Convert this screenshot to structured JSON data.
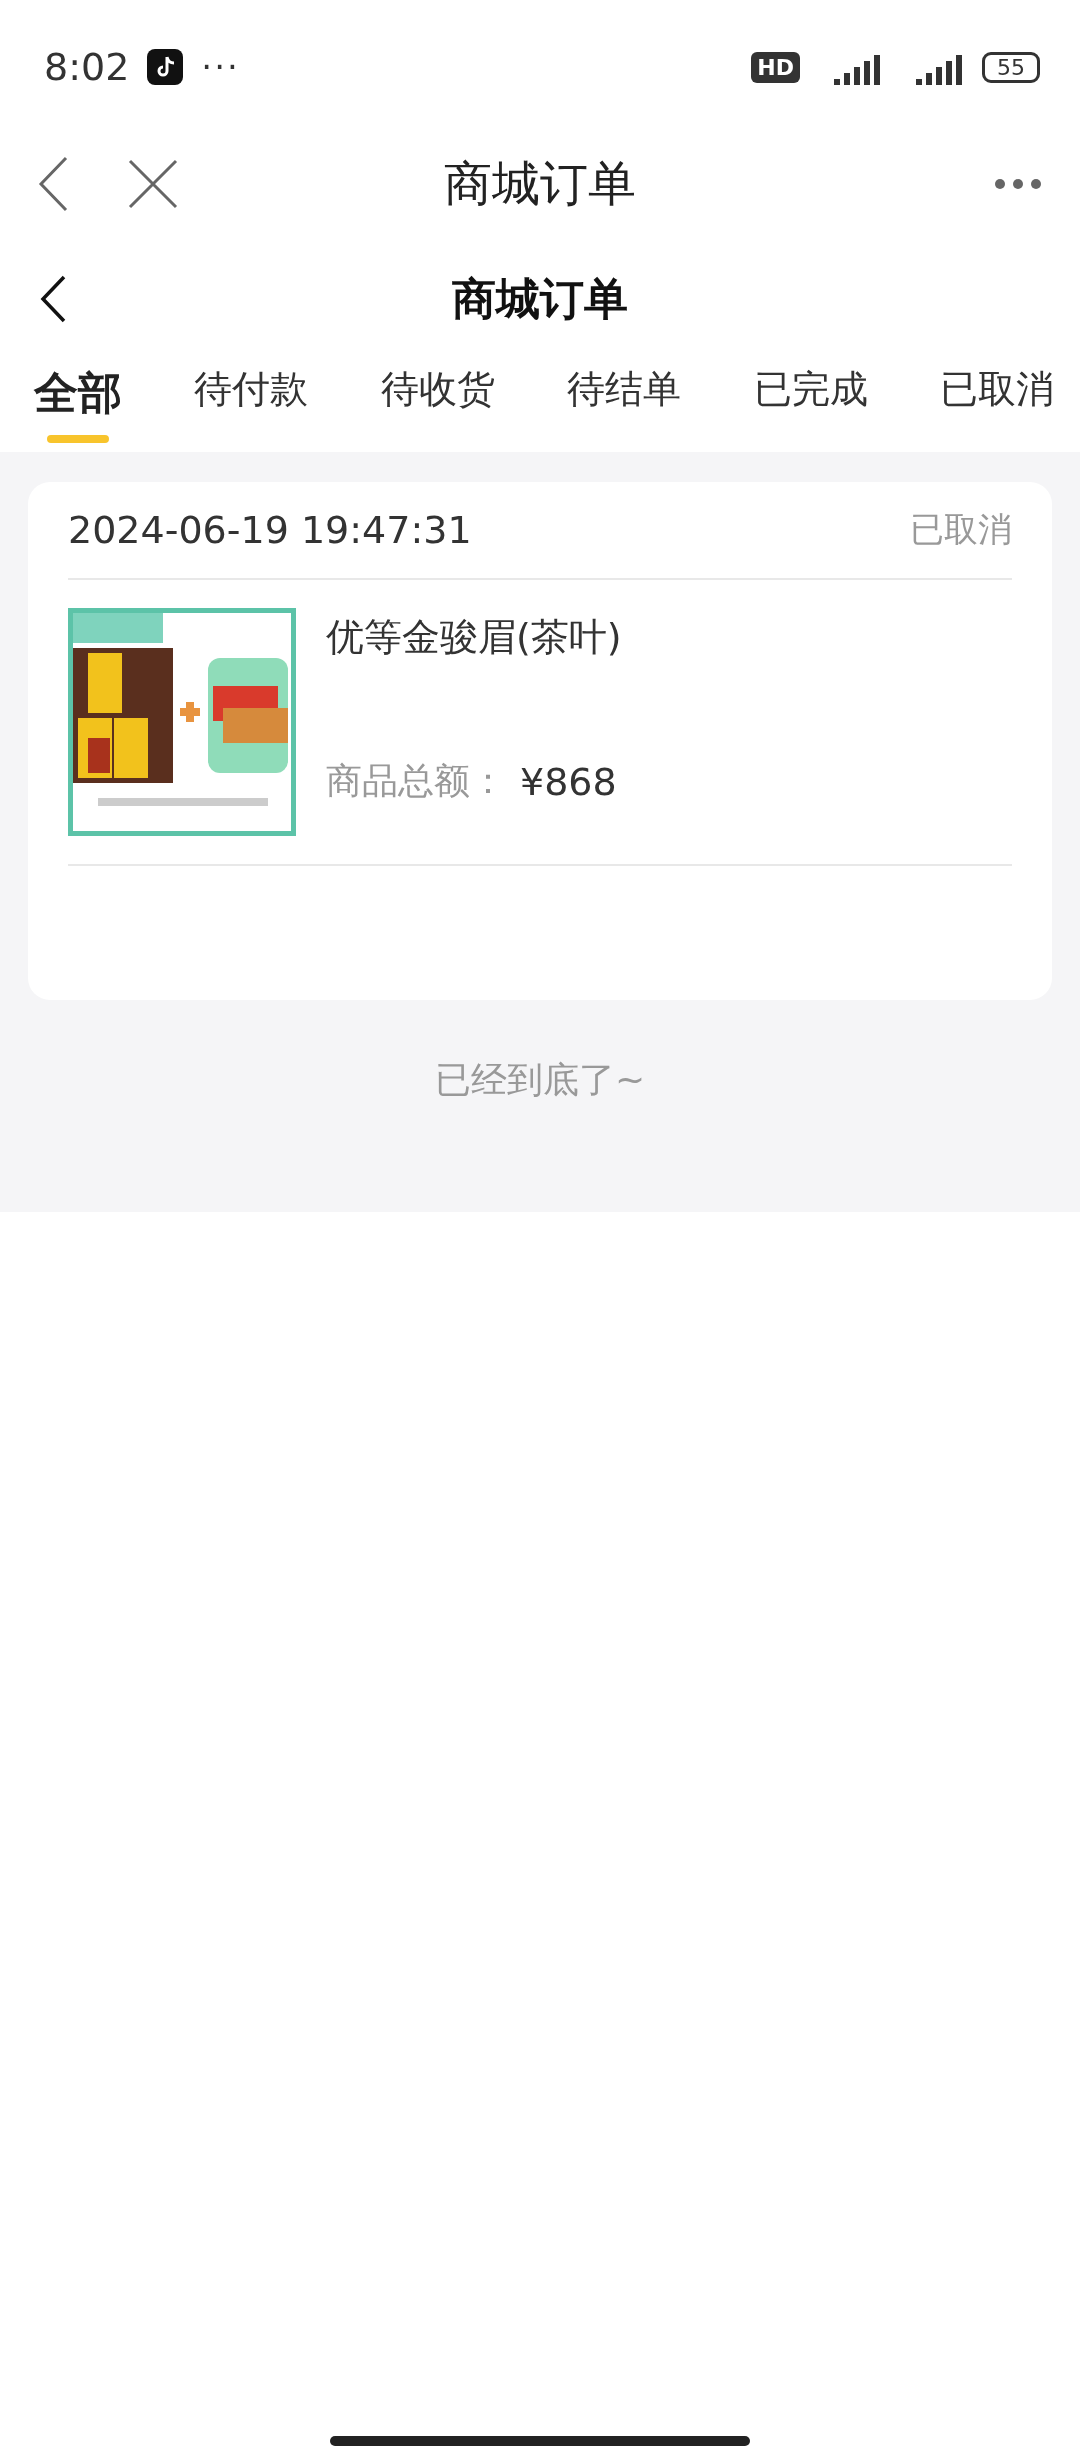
{
  "status_bar": {
    "time": "8:02",
    "more": "···",
    "hd": "HD",
    "battery": "55"
  },
  "browser_bar": {
    "title": "商城订单"
  },
  "header": {
    "title": "商城订单"
  },
  "tabs": [
    {
      "label": "全部",
      "selected": true
    },
    {
      "label": "待付款",
      "selected": false
    },
    {
      "label": "待收货",
      "selected": false
    },
    {
      "label": "待结单",
      "selected": false
    },
    {
      "label": "已完成",
      "selected": false
    },
    {
      "label": "已取消",
      "selected": false
    }
  ],
  "orders": [
    {
      "time": "2024-06-19 19:47:31",
      "status": "已取消",
      "product": {
        "kind": "picture",
        "name": "优等金骏眉(茶叶)",
        "total_label": "商品总额：",
        "total": "¥868"
      }
    }
  ],
  "end_note": "已经到底了~"
}
